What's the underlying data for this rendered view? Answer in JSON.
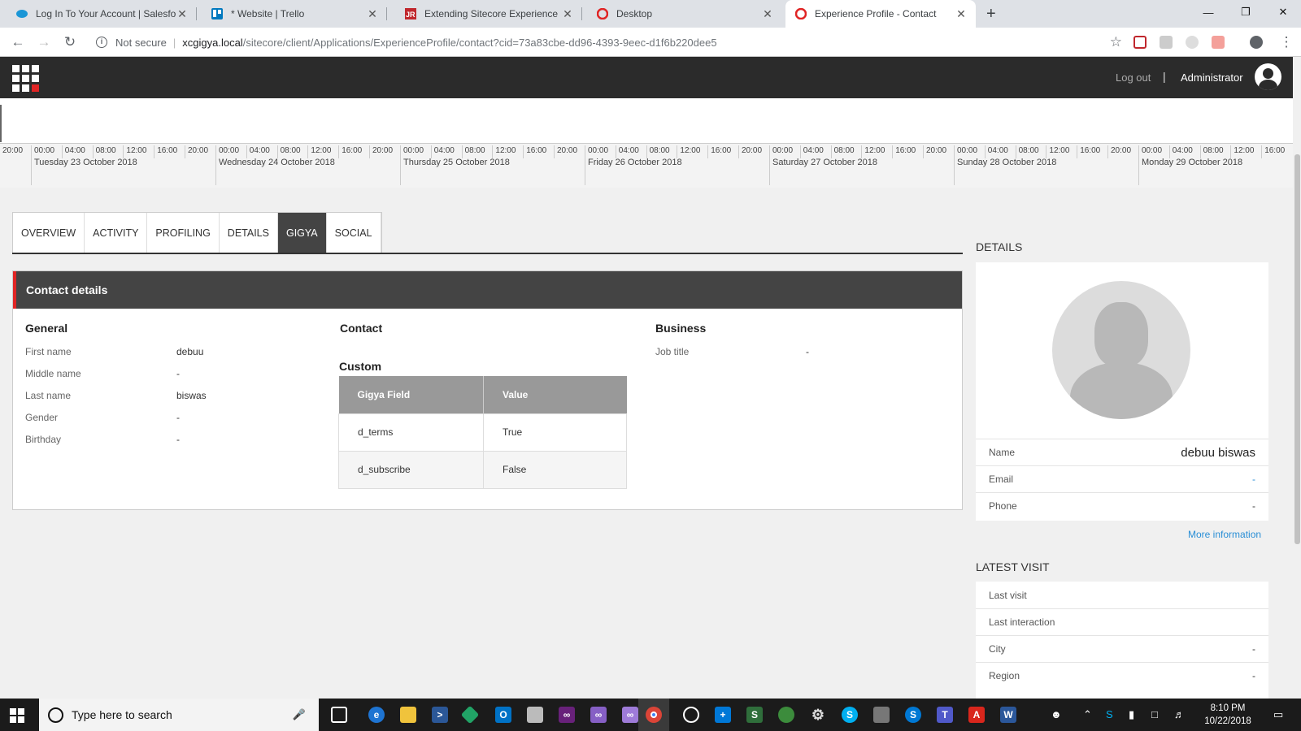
{
  "browser": {
    "tabs": [
      {
        "title": "Log In To Your Account | Salesfor",
        "icon": "salesforce-cloud-icon"
      },
      {
        "title": "* Website | Trello",
        "icon": "trello-icon"
      },
      {
        "title": "Extending Sitecore Experience Pr",
        "icon": "jr-icon"
      },
      {
        "title": "Desktop",
        "icon": "sitecore-icon"
      },
      {
        "title": "Experience Profile - Contact",
        "icon": "sitecore-icon"
      }
    ],
    "address": {
      "security": "Not secure",
      "host": "xcgigya.local",
      "path": "/sitecore/client/Applications/ExperienceProfile/contact?cid=73a83cbe-dd96-4393-9eec-d1f6b220dee5"
    }
  },
  "header": {
    "logout_label": "Log out",
    "separator": "|",
    "user_label": "Administrator"
  },
  "timeline": {
    "days": [
      {
        "label": "Tuesday 23 October 2018"
      },
      {
        "label": "Wednesday 24 October 2018"
      },
      {
        "label": "Thursday 25 October 2018"
      },
      {
        "label": "Friday 26 October 2018"
      },
      {
        "label": "Saturday 27 October 2018"
      },
      {
        "label": "Sunday 28 October 2018"
      },
      {
        "label": "Monday 29 October 2018"
      }
    ],
    "leading_tick": "20:00",
    "hour_ticks": [
      "00:00",
      "04:00",
      "08:00",
      "12:00",
      "16:00",
      "20:00"
    ]
  },
  "tabs": [
    {
      "label": "OVERVIEW"
    },
    {
      "label": "ACTIVITY"
    },
    {
      "label": "PROFILING"
    },
    {
      "label": "DETAILS"
    },
    {
      "label": "GIGYA",
      "active": true
    },
    {
      "label": "SOCIAL"
    }
  ],
  "contact_details": {
    "title": "Contact details",
    "general": {
      "heading": "General",
      "rows": [
        {
          "label": "First name",
          "value": "debuu"
        },
        {
          "label": "Middle name",
          "value": "-"
        },
        {
          "label": "Last name",
          "value": "biswas"
        },
        {
          "label": "Gender",
          "value": "-"
        },
        {
          "label": "Birthday",
          "value": "-"
        }
      ]
    },
    "contact": {
      "heading": "Contact"
    },
    "custom": {
      "heading": "Custom",
      "columns": [
        "Gigya Field",
        "Value"
      ],
      "rows": [
        {
          "field": "d_terms",
          "value": "True"
        },
        {
          "field": "d_subscribe",
          "value": "False"
        }
      ]
    },
    "business": {
      "heading": "Business",
      "rows": [
        {
          "label": "Job title",
          "value": "-"
        }
      ]
    }
  },
  "sidebar": {
    "details": {
      "title": "DETAILS",
      "rows": [
        {
          "label": "Name",
          "value": "debuu biswas"
        },
        {
          "label": "Email",
          "value": "-"
        },
        {
          "label": "Phone",
          "value": "-"
        }
      ],
      "more_label": "More information"
    },
    "latest_visit": {
      "title": "LATEST VISIT",
      "rows": [
        {
          "label": "Last visit",
          "value": ""
        },
        {
          "label": "Last interaction",
          "value": ""
        },
        {
          "label": "City",
          "value": "-"
        },
        {
          "label": "Region",
          "value": "-"
        }
      ]
    }
  },
  "taskbar": {
    "search_placeholder": "Type here to search",
    "time": "8:10 PM",
    "date": "10/22/2018"
  },
  "colors": {
    "sitecore_header": "#2b2b2b",
    "accent_red": "#e02424",
    "link_blue": "#2a8fd6",
    "active_tab": "#444444"
  }
}
